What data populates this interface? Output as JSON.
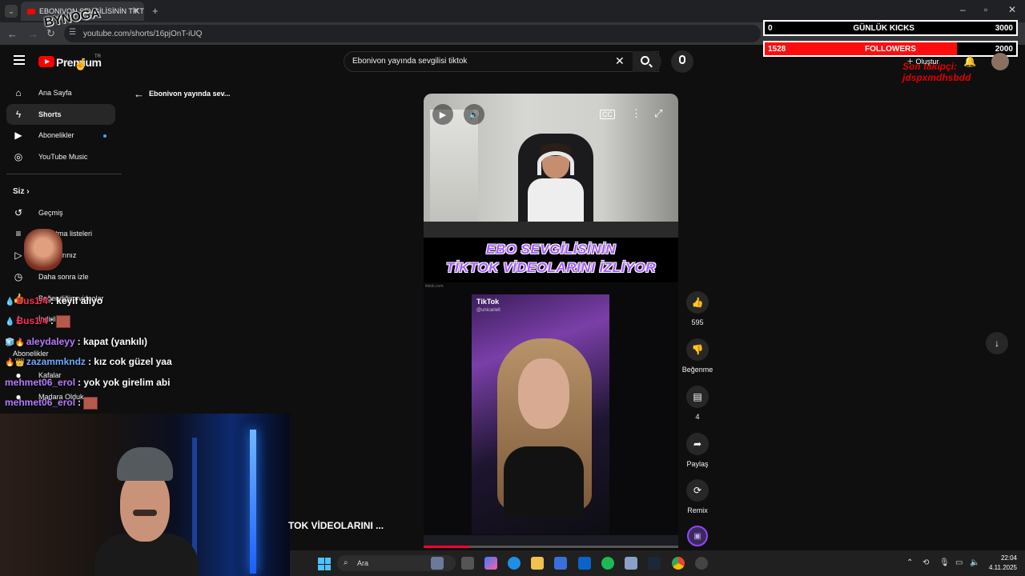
{
  "browser": {
    "tab_title": "EBONIVON SEVGİLİSİNİN TİKTO",
    "url": "youtube.com/shorts/16pjOnT-iUQ",
    "overlay_logo": "BYNOGA"
  },
  "stream_overlay": {
    "kicks": {
      "current": "0",
      "label": "GÜNLÜK KICKS",
      "goal": "3000"
    },
    "followers": {
      "current": "1528",
      "label": "FOLLOWERS",
      "goal": "2000",
      "progress": 0.764
    },
    "last_follower": "Son takipçi: jdspxmdhsbdd"
  },
  "header": {
    "brand": "Premium",
    "country": "TR",
    "search_value": "Ebonivon yayında sevgilisi tiktok",
    "create_label": "Oluştur"
  },
  "sidebar": {
    "items": [
      {
        "label": "Ana Sayfa",
        "icon": "home-icon"
      },
      {
        "label": "Shorts",
        "icon": "shorts-icon"
      },
      {
        "label": "Abonelikler",
        "icon": "subscriptions-icon"
      },
      {
        "label": "YouTube Music",
        "icon": "music-icon"
      }
    ],
    "you_heading": "Siz",
    "you_items": [
      {
        "label": "Geçmiş",
        "icon": "history-icon"
      },
      {
        "label": "Oynatma listeleri",
        "icon": "playlist-icon"
      },
      {
        "label": "Videolarınız",
        "icon": "videos-icon"
      },
      {
        "label": "Daha sonra izle",
        "icon": "watch-later-icon"
      },
      {
        "label": "Beğendiğim videolar",
        "icon": "like-icon"
      },
      {
        "label": "İndirilen",
        "icon": "download-icon"
      }
    ],
    "subscriptions_heading": "Abonelikler",
    "subscriptions": [
      {
        "label": "Kafalar"
      },
      {
        "label": "Madara Olduk"
      }
    ]
  },
  "short": {
    "title": "Ebonivon yayında sev...",
    "caption_line1": "EBO SEVGİLİSİNİN",
    "caption_line2": "TİKTOK VİDEOLARINI İZLİYOR",
    "tiktok_brand": "TikTok",
    "tiktok_user": "@unicariell",
    "bottom_title": "TOK VİDEOLARINI ...",
    "progress": 0.18
  },
  "actions": {
    "likes": "595",
    "dislike_label": "Beğenme",
    "comments": "4",
    "share_label": "Paylaş",
    "remix_label": "Remix"
  },
  "chat": [
    {
      "user": "Bus1/4",
      "message": ": keyif aliyo",
      "color": "#ff2d55",
      "badges": "💧"
    },
    {
      "user": "Bus1/4",
      "message": ":",
      "color": "#ff2d55",
      "badges": "💧",
      "emote": true
    },
    {
      "user": "aleydaleyy",
      "message": ": kapat (yankılı)",
      "color": "#b57bff",
      "badges": "🧊🔥"
    },
    {
      "user": "zazammkndz",
      "message": ": kız cok güzel yaa",
      "color": "#6fa8ff",
      "badges": "🔥👑"
    },
    {
      "user": "mehmet06_erol",
      "message": ": yok yok girelim abi",
      "color": "#b57bff",
      "badges": ""
    },
    {
      "user": "mehmet06_erol",
      "message": ":",
      "color": "#b57bff",
      "badges": "",
      "emote": true
    }
  ],
  "taskbar": {
    "search_label": "Ara",
    "time": "22:04",
    "date": "4.11.2025"
  }
}
